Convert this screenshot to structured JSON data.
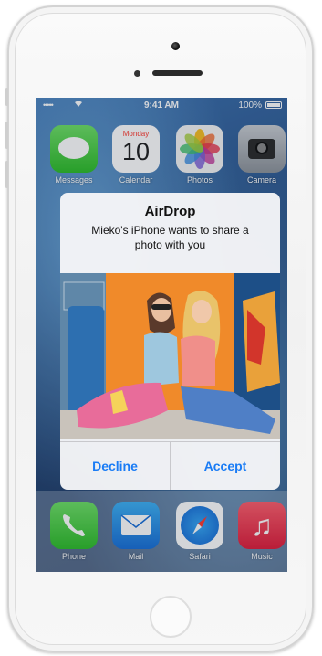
{
  "status_bar": {
    "signal": "•••••",
    "time": "9:41 AM",
    "battery": "100%"
  },
  "home_screen": {
    "apps": [
      {
        "label": "Messages",
        "icon": "messages-icon"
      },
      {
        "label": "Calendar",
        "icon": "calendar-icon",
        "weekday": "Monday",
        "day": "10"
      },
      {
        "label": "Photos",
        "icon": "photos-icon"
      },
      {
        "label": "Camera",
        "icon": "camera-icon"
      }
    ],
    "dock": [
      {
        "label": "Phone",
        "icon": "phone-icon"
      },
      {
        "label": "Mail",
        "icon": "mail-icon"
      },
      {
        "label": "Safari",
        "icon": "safari-icon"
      },
      {
        "label": "Music",
        "icon": "music-icon"
      }
    ]
  },
  "alert": {
    "title": "AirDrop",
    "message": "Mieko's iPhone wants to share a photo with you",
    "decline_label": "Decline",
    "accept_label": "Accept"
  },
  "colors": {
    "button_text": "#1a7cf5",
    "messages_green": "#2fbd2b",
    "music_red": "#e01f3d"
  }
}
